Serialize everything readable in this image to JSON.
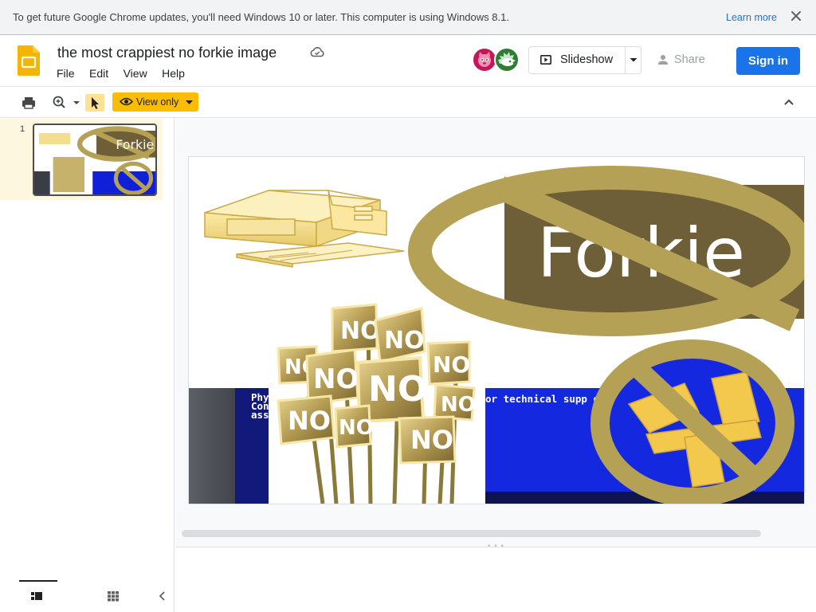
{
  "browser": {
    "infobar": {
      "message": "To get future Google Chrome updates, you'll need Windows 10 or later. This computer is using Windows 8.1.",
      "learn_more": "Learn more",
      "close_icon": "close-icon"
    }
  },
  "header": {
    "app_icon": "google-slides-logo",
    "doc_title": "the most crappiest no forkie image",
    "status_icon": "cloud-saved-icon",
    "menu": [
      "File",
      "Edit",
      "View",
      "Help"
    ],
    "slideshow_label": "Slideshow",
    "share_label": "Share",
    "signin_label": "Sign in"
  },
  "toolbar": {
    "icons": [
      "print-icon",
      "zoom-icon",
      "select-pointer-icon",
      "collapse-up-icon"
    ],
    "view_mode_label": "View only"
  },
  "filmstrip": {
    "slides": [
      {
        "number": "1"
      }
    ],
    "footer_icons": [
      "list-view-icon",
      "grid-view-icon",
      "collapse-left-icon"
    ]
  },
  "slide": {
    "no_sign_text": "NO",
    "forkie_text": "Forkie",
    "bsod_lines": [
      "Phy",
      "Con",
      "ass",
      "or technical supp   grou    furt"
    ]
  },
  "colors": {
    "accent_blue": "#1a73e8",
    "view_only_yellow": "#fbbc04",
    "gold": "#b5a155",
    "bsod_blue": "#0a1ee6"
  }
}
